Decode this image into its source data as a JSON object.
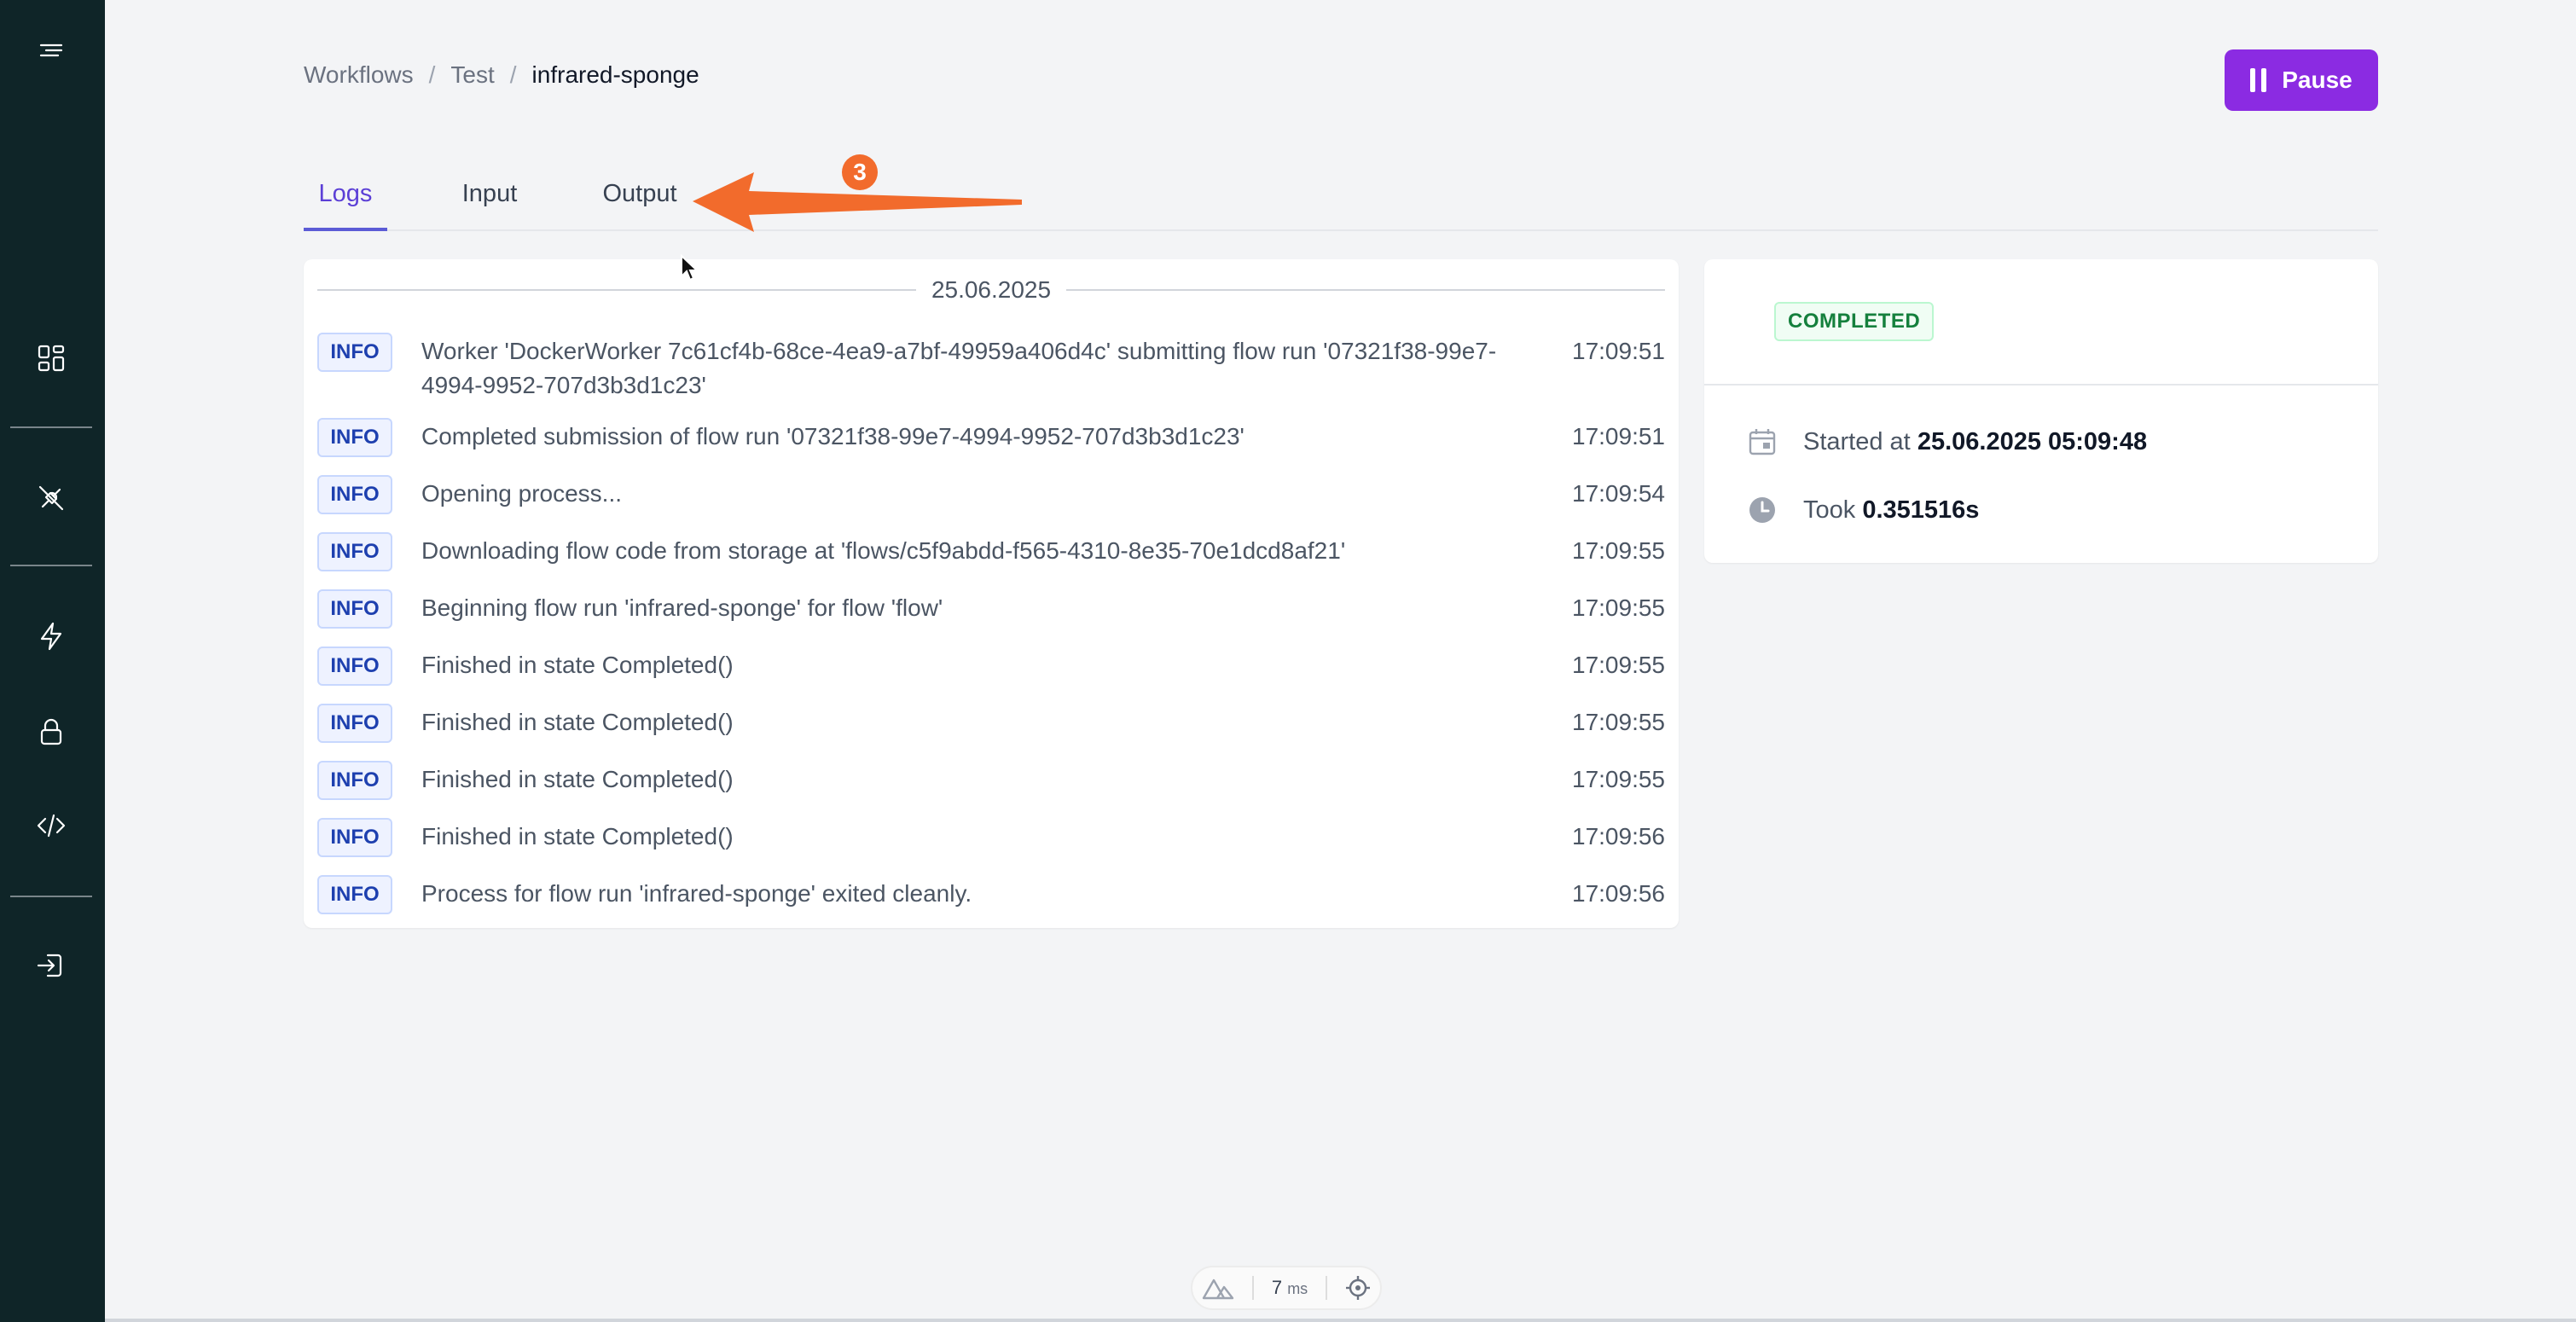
{
  "breadcrumb": {
    "workflows": "Workflows",
    "test": "Test",
    "current": "infrared-sponge",
    "sep": "/"
  },
  "header": {
    "pause_label": "Pause"
  },
  "tabs": [
    {
      "label": "Logs",
      "active": true
    },
    {
      "label": "Input",
      "active": false
    },
    {
      "label": "Output",
      "active": false
    }
  ],
  "annotation": {
    "badge": "3",
    "color": "#f26b2c"
  },
  "logs": {
    "date": "25.06.2025",
    "rows": [
      {
        "level": "INFO",
        "message": "Worker 'DockerWorker 7c61cf4b-68ce-4ea9-a7bf-49959a406d4c' submitting flow run '07321f38-99e7-4994-9952-707d3b3d1c23'",
        "time": "17:09:51"
      },
      {
        "level": "INFO",
        "message": "Completed submission of flow run '07321f38-99e7-4994-9952-707d3b3d1c23'",
        "time": "17:09:51"
      },
      {
        "level": "INFO",
        "message": "Opening process...",
        "time": "17:09:54"
      },
      {
        "level": "INFO",
        "message": "Downloading flow code from storage at 'flows/c5f9abdd-f565-4310-8e35-70e1dcd8af21'",
        "time": "17:09:55"
      },
      {
        "level": "INFO",
        "message": "Beginning flow run 'infrared-sponge' for flow 'flow'",
        "time": "17:09:55"
      },
      {
        "level": "INFO",
        "message": "Finished in state Completed()",
        "time": "17:09:55"
      },
      {
        "level": "INFO",
        "message": "Finished in state Completed()",
        "time": "17:09:55"
      },
      {
        "level": "INFO",
        "message": "Finished in state Completed()",
        "time": "17:09:55"
      },
      {
        "level": "INFO",
        "message": "Finished in state Completed()",
        "time": "17:09:56"
      },
      {
        "level": "INFO",
        "message": "Process for flow run 'infrared-sponge' exited cleanly.",
        "time": "17:09:56"
      }
    ]
  },
  "status": {
    "badge": "COMPLETED",
    "started_label": "Started at",
    "started_value": "25.06.2025 05:09:48",
    "took_label": "Took",
    "took_value": "0.351516s"
  },
  "devbar": {
    "ms_value": "7",
    "ms_unit": "ms"
  },
  "colors": {
    "sidebar": "#0f2528",
    "accent": "#8b2be2",
    "tab_active": "#5b5bd6",
    "completed": "#15803d"
  },
  "sidebar_icons": [
    "menu-icon",
    "dashboard-icon",
    "plug-icon",
    "lightning-icon",
    "lock-icon",
    "code-icon",
    "logout-icon"
  ]
}
